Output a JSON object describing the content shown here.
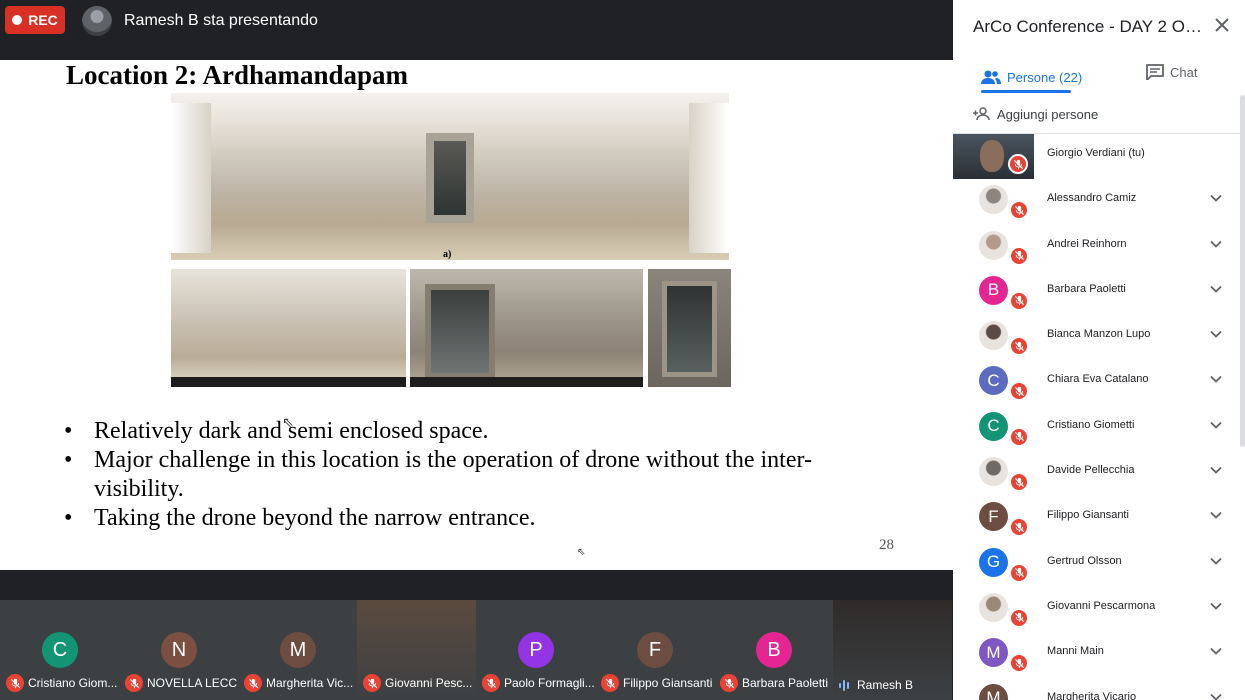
{
  "topbar": {
    "rec_label": "REC",
    "presenter_text": "Ramesh B sta presentando"
  },
  "slide": {
    "title": "Location 2: Ardhamandapam",
    "pano_label": "a)",
    "bullets": [
      "Relatively dark and semi enclosed space.",
      "Major challenge in this location is the operation of drone without the inter-visibility.",
      "Taking the drone beyond the narrow entrance."
    ],
    "page_number": "28"
  },
  "strip": [
    {
      "initial": "C",
      "name": "Cristiano Giom...",
      "color": "#129475",
      "talking": false,
      "video": false
    },
    {
      "initial": "N",
      "name": "NOVELLA LECCI",
      "color": "#7b4f42",
      "talking": false,
      "video": false
    },
    {
      "initial": "M",
      "name": "Margherita Vic...",
      "color": "#6d4c41",
      "talking": false,
      "video": false
    },
    {
      "initial": "",
      "name": "Giovanni Pesc...",
      "color": "#5b4a3e",
      "talking": false,
      "video": true
    },
    {
      "initial": "P",
      "name": "Paolo Formagli...",
      "color": "#9334e6",
      "talking": false,
      "video": false
    },
    {
      "initial": "F",
      "name": "Filippo Giansanti",
      "color": "#6d4c41",
      "talking": false,
      "video": false
    },
    {
      "initial": "B",
      "name": "Barbara Paoletti",
      "color": "#e52592",
      "talking": false,
      "video": false
    },
    {
      "initial": "",
      "name": "Ramesh B",
      "color": "#2f2b2a",
      "talking": true,
      "video": true
    }
  ],
  "panel": {
    "title": "ArCo Conference - DAY 2 ONLIN...",
    "tab_people": "Persone (22)",
    "tab_chat": "Chat",
    "add_people": "Aggiungi persone",
    "people": [
      {
        "name": "Giorgio Verdiani (tu)",
        "initial": "",
        "color": "#3c4043",
        "self": true,
        "photo": true
      },
      {
        "name": "Alessandro Camiz",
        "initial": "",
        "color": "#8d8680",
        "self": false,
        "photo": true
      },
      {
        "name": "Andrei Reinhorn",
        "initial": "",
        "color": "#b39a8a",
        "self": false,
        "photo": true
      },
      {
        "name": "Barbara Paoletti",
        "initial": "B",
        "color": "#e52592",
        "self": false,
        "photo": false
      },
      {
        "name": "Bianca Manzon Lupo",
        "initial": "",
        "color": "#5c4a44",
        "self": false,
        "photo": true
      },
      {
        "name": "Chiara Eva Catalano",
        "initial": "C",
        "color": "#5c6bc0",
        "self": false,
        "photo": false
      },
      {
        "name": "Cristiano Giometti",
        "initial": "C",
        "color": "#129475",
        "self": false,
        "photo": false
      },
      {
        "name": "Davide Pellecchia",
        "initial": "",
        "color": "#6f6a66",
        "self": false,
        "photo": true
      },
      {
        "name": "Filippo Giansanti",
        "initial": "F",
        "color": "#6d4c41",
        "self": false,
        "photo": false
      },
      {
        "name": "Gertrud Olsson",
        "initial": "G",
        "color": "#1a73e8",
        "self": false,
        "photo": false
      },
      {
        "name": "Giovanni Pescarmona",
        "initial": "",
        "color": "#9a8878",
        "self": false,
        "photo": true
      },
      {
        "name": "Manni Main",
        "initial": "M",
        "color": "#7e57c2",
        "self": false,
        "photo": false
      },
      {
        "name": "Margherita Vicario",
        "initial": "M",
        "color": "#6d4c41",
        "self": false,
        "photo": false
      }
    ]
  },
  "colors": {
    "accent": "#1a73e8",
    "mic_off": "#ea4335",
    "rec": "#d93025"
  }
}
